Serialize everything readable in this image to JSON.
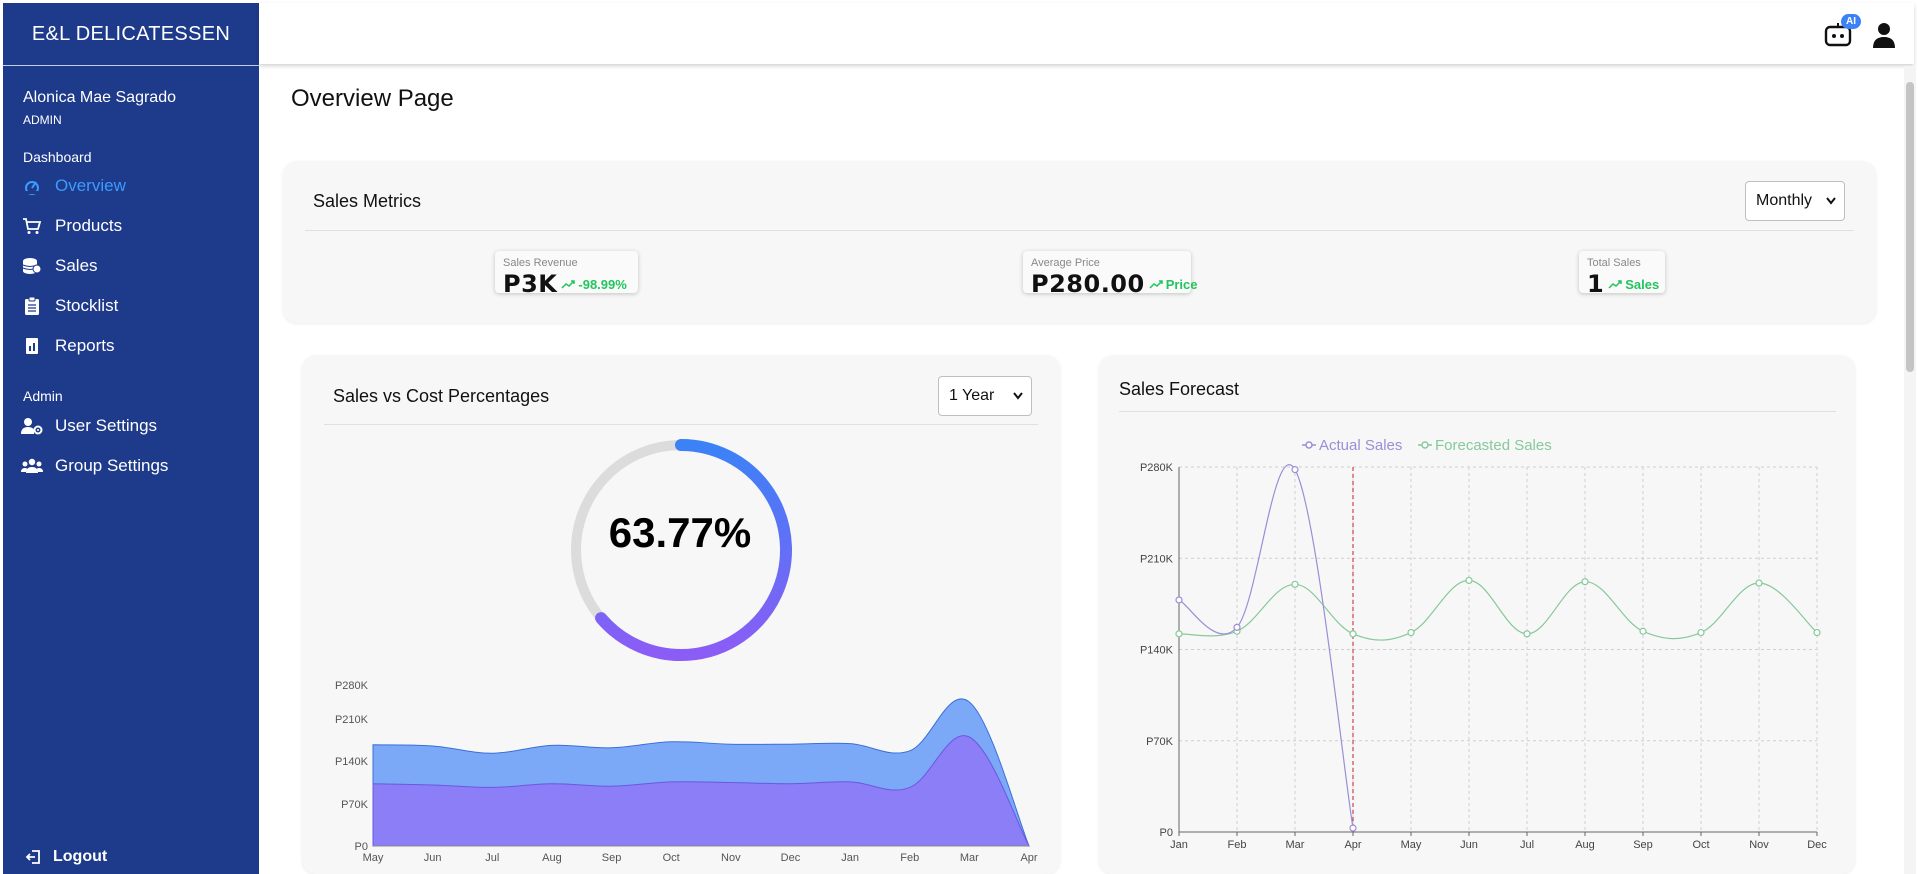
{
  "sidebar": {
    "brand": "E&L DELICATESSEN",
    "user_name": "Alonica Mae Sagrado",
    "user_role": "ADMIN",
    "section_dashboard": "Dashboard",
    "section_admin": "Admin",
    "items": [
      {
        "label": "Overview",
        "icon": "overview-icon",
        "active": true
      },
      {
        "label": "Products",
        "icon": "cart-icon"
      },
      {
        "label": "Sales",
        "icon": "coins-icon"
      },
      {
        "label": "Stocklist",
        "icon": "clipboard-icon"
      },
      {
        "label": "Reports",
        "icon": "report-icon"
      },
      {
        "label": "User Settings",
        "icon": "user-gear-icon"
      },
      {
        "label": "Group Settings",
        "icon": "group-icon"
      }
    ],
    "logout_label": "Logout",
    "active_color": "#3b9bff",
    "background": "#1e3a8a"
  },
  "topbar": {
    "ai_badge": "AI",
    "icons": [
      "ai-assistant-icon",
      "user-icon"
    ]
  },
  "page_title": "Overview Page",
  "sales_metrics": {
    "title": "Sales Metrics",
    "period_select": "Monthly",
    "metrics": [
      {
        "label": "Sales Revenue",
        "value": "P3K",
        "change": "-98.99%"
      },
      {
        "label": "Average Price",
        "value": "P280.00",
        "change": "Price"
      },
      {
        "label": "Total Sales",
        "value": "1",
        "change": "Sales"
      }
    ]
  },
  "sales_vs_cost": {
    "title": "Sales vs Cost Percentages",
    "range_select": "1 Year",
    "gauge_text": "63.77%",
    "gauge_value": 63.77
  },
  "sales_forecast": {
    "title": "Sales Forecast",
    "legend": [
      "Actual Sales",
      "Forecasted Sales"
    ]
  },
  "chart_data": [
    {
      "type": "pie",
      "description_free": true,
      "values": [
        63.77,
        36.23
      ],
      "colors": [
        "#8b5cf6",
        "#dcdcdc"
      ],
      "center_text": "63.77%"
    },
    {
      "type": "area",
      "categories": [
        "May",
        "Jun",
        "Jul",
        "Aug",
        "Sep",
        "Oct",
        "Nov",
        "Dec",
        "Jan",
        "Feb",
        "Mar",
        "Apr"
      ],
      "series": [
        {
          "values": [
            167,
            165,
            153,
            166,
            162,
            172,
            168,
            168,
            169,
            157,
            245,
            0
          ],
          "color": "#7ba9f7"
        },
        {
          "values": [
            103,
            101,
            97,
            103,
            99,
            106,
            105,
            103,
            106,
            97,
            180,
            0
          ],
          "color": "#8b7ef7"
        }
      ],
      "y_ticks": [
        "P0",
        "P70K",
        "P140K",
        "P210K",
        "P280K"
      ],
      "ylim": [
        0,
        280
      ],
      "y_unit": "K"
    },
    {
      "type": "line",
      "categories": [
        "Jan",
        "Feb",
        "Mar",
        "Apr",
        "May",
        "Jun",
        "Jul",
        "Aug",
        "Sep",
        "Oct",
        "Nov",
        "Dec"
      ],
      "series": [
        {
          "name": "Actual Sales",
          "values": [
            178,
            157,
            278,
            3,
            null,
            null,
            null,
            null,
            null,
            null,
            null,
            null
          ],
          "color": "#9a8ed6"
        },
        {
          "name": "Forecasted Sales",
          "values": [
            152,
            154,
            190,
            152,
            153,
            193,
            152,
            192,
            154,
            153,
            191,
            153
          ],
          "color": "#86c99a"
        }
      ],
      "y_ticks": [
        "P0",
        "P70K",
        "P140K",
        "P210K",
        "P280K"
      ],
      "ylim": [
        0,
        280
      ],
      "y_unit": "K",
      "marker_category": "Apr",
      "grid": true,
      "legend_position": "top-center"
    }
  ]
}
